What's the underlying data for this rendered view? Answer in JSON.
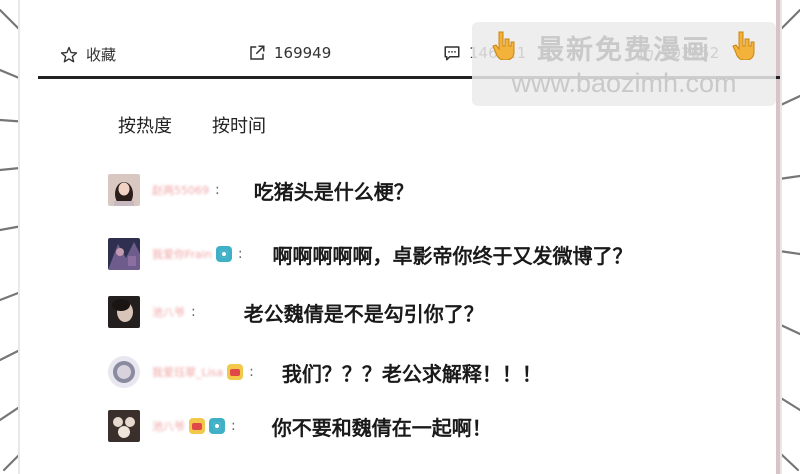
{
  "actions": {
    "favorite": {
      "label": "收藏",
      "icon": "star-icon"
    },
    "share": {
      "label": "169949",
      "icon": "share-icon"
    },
    "comment": {
      "label": "146611",
      "icon": "comment-icon"
    },
    "like": {
      "label": "902652",
      "icon": "thumbs-up-icon"
    }
  },
  "sort": {
    "hot": "按热度",
    "time": "按时间"
  },
  "comments": [
    {
      "user": "赵两55069",
      "text": "吃猪头是什么梗？"
    },
    {
      "user": "我爱你Frain",
      "text": "啊啊啊啊啊，卓影帝你终于又发微博了？"
    },
    {
      "user": "池八爷",
      "text": "老公魏倩是不是勾引你了？"
    },
    {
      "user": "我爱珏翠_Lisa",
      "text": "我们？？？老公求解释！！！"
    },
    {
      "user": "池八爷",
      "text": "你不要和魏倩在一起啊！"
    }
  ],
  "watermark": {
    "line1": "最新免费漫画",
    "line2": "www.baozimh.com"
  },
  "colors": {
    "divider": "#222222",
    "username": "#f0a6a6",
    "badge_cam": "#3fb0c6",
    "badge_vip": "#f2c84b",
    "watermark_bg": "#ebebeb"
  }
}
